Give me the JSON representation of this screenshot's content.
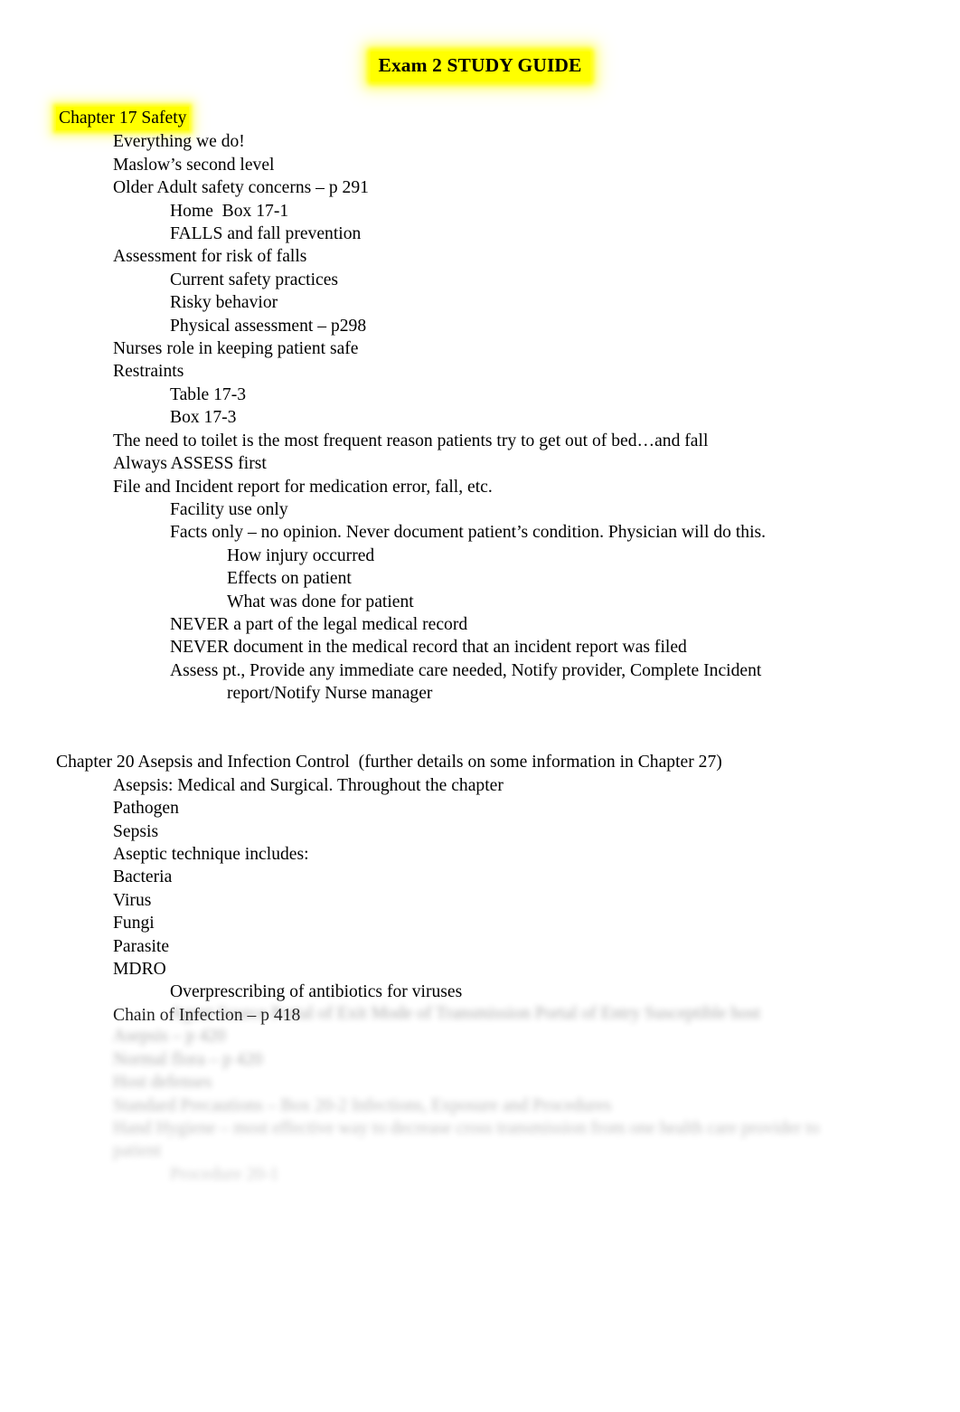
{
  "document": {
    "title": "Exam 2 STUDY GUIDE",
    "highlight_color": "#ffff00"
  },
  "sections": [
    {
      "heading": "Chapter 17 Safety",
      "heading_highlighted": true,
      "lines": [
        {
          "level": 1,
          "text": "Everything we do!"
        },
        {
          "level": 1,
          "text": "Maslow’s second level"
        },
        {
          "level": 1,
          "text": "Older Adult safety concerns – p 291"
        },
        {
          "level": 2,
          "text": "Home  Box 17-1"
        },
        {
          "level": 2,
          "text": "FALLS and fall prevention"
        },
        {
          "level": 1,
          "text": "Assessment for risk of falls"
        },
        {
          "level": 2,
          "text": "Current safety practices"
        },
        {
          "level": 2,
          "text": "Risky behavior"
        },
        {
          "level": 2,
          "text": "Physical assessment – p298"
        },
        {
          "level": 1,
          "text": "Nurses role in keeping patient safe"
        },
        {
          "level": 1,
          "text": "Restraints"
        },
        {
          "level": 2,
          "text": "Table 17-3"
        },
        {
          "level": 2,
          "text": "Box 17-3"
        },
        {
          "level": 1,
          "text": "The need to toilet is the most frequent reason patients try to get out of bed…and fall"
        },
        {
          "level": 1,
          "text": "Always ASSESS first"
        },
        {
          "level": 1,
          "text": "File and Incident report for medication error, fall, etc."
        },
        {
          "level": 2,
          "text": "Facility use only"
        },
        {
          "level": 2,
          "text": "Facts only – no opinion. Never document patient’s condition. Physician will do this."
        },
        {
          "level": 3,
          "text": "How injury occurred"
        },
        {
          "level": 3,
          "text": "Effects on patient"
        },
        {
          "level": 3,
          "text": "What was done for patient"
        },
        {
          "level": 2,
          "text": "NEVER a part of the legal medical record"
        },
        {
          "level": 2,
          "text": "NEVER document in the medical record that an incident report was filed"
        }
      ],
      "wrapped_line": {
        "level": 2,
        "text": "Assess pt., Provide any immediate care needed, Notify provider, Complete Incident",
        "continuation": "report/Notify Nurse manager"
      }
    },
    {
      "heading": "Chapter 20 Asepsis and Infection Control  (further details on some information in Chapter 27)",
      "heading_highlighted": false,
      "lines": [
        {
          "level": 1,
          "text": "Asepsis: Medical and Surgical. Throughout the chapter"
        },
        {
          "level": 1,
          "text": "Pathogen"
        },
        {
          "level": 1,
          "text": "Sepsis"
        },
        {
          "level": 1,
          "text": "Aseptic technique includes:"
        },
        {
          "level": 1,
          "text": "Bacteria"
        },
        {
          "level": 1,
          "text": "Virus"
        },
        {
          "level": 1,
          "text": "Fungi"
        },
        {
          "level": 1,
          "text": "Parasite"
        },
        {
          "level": 1,
          "text": "MDRO"
        },
        {
          "level": 2,
          "text": "Overprescribing of antibiotics for viruses"
        },
        {
          "level": 1,
          "text": "Chain of Infection – p 418"
        }
      ]
    }
  ],
  "obscured_section": {
    "note": "Remaining content is blurred and illegible in the source image.",
    "lines": [
      {
        "level": 2,
        "text": "Agent Source Portal of Exit Mode of Transmission Portal of Entry Susceptible host"
      },
      {
        "level": 1,
        "text": "Asepsis – p 420"
      },
      {
        "level": 1,
        "text": "Normal flora – p 420"
      },
      {
        "level": 1,
        "text": "Host defenses"
      },
      {
        "level": 1,
        "text": "Standard Precautions – Box 20-2 Infections, Exposure and Procedures"
      },
      {
        "level": 1,
        "text": "Hand Hygiene – most effective way to decrease cross transmission from one health care provider to patient"
      },
      {
        "level": 2,
        "text": "Procedure 20-1"
      }
    ]
  }
}
